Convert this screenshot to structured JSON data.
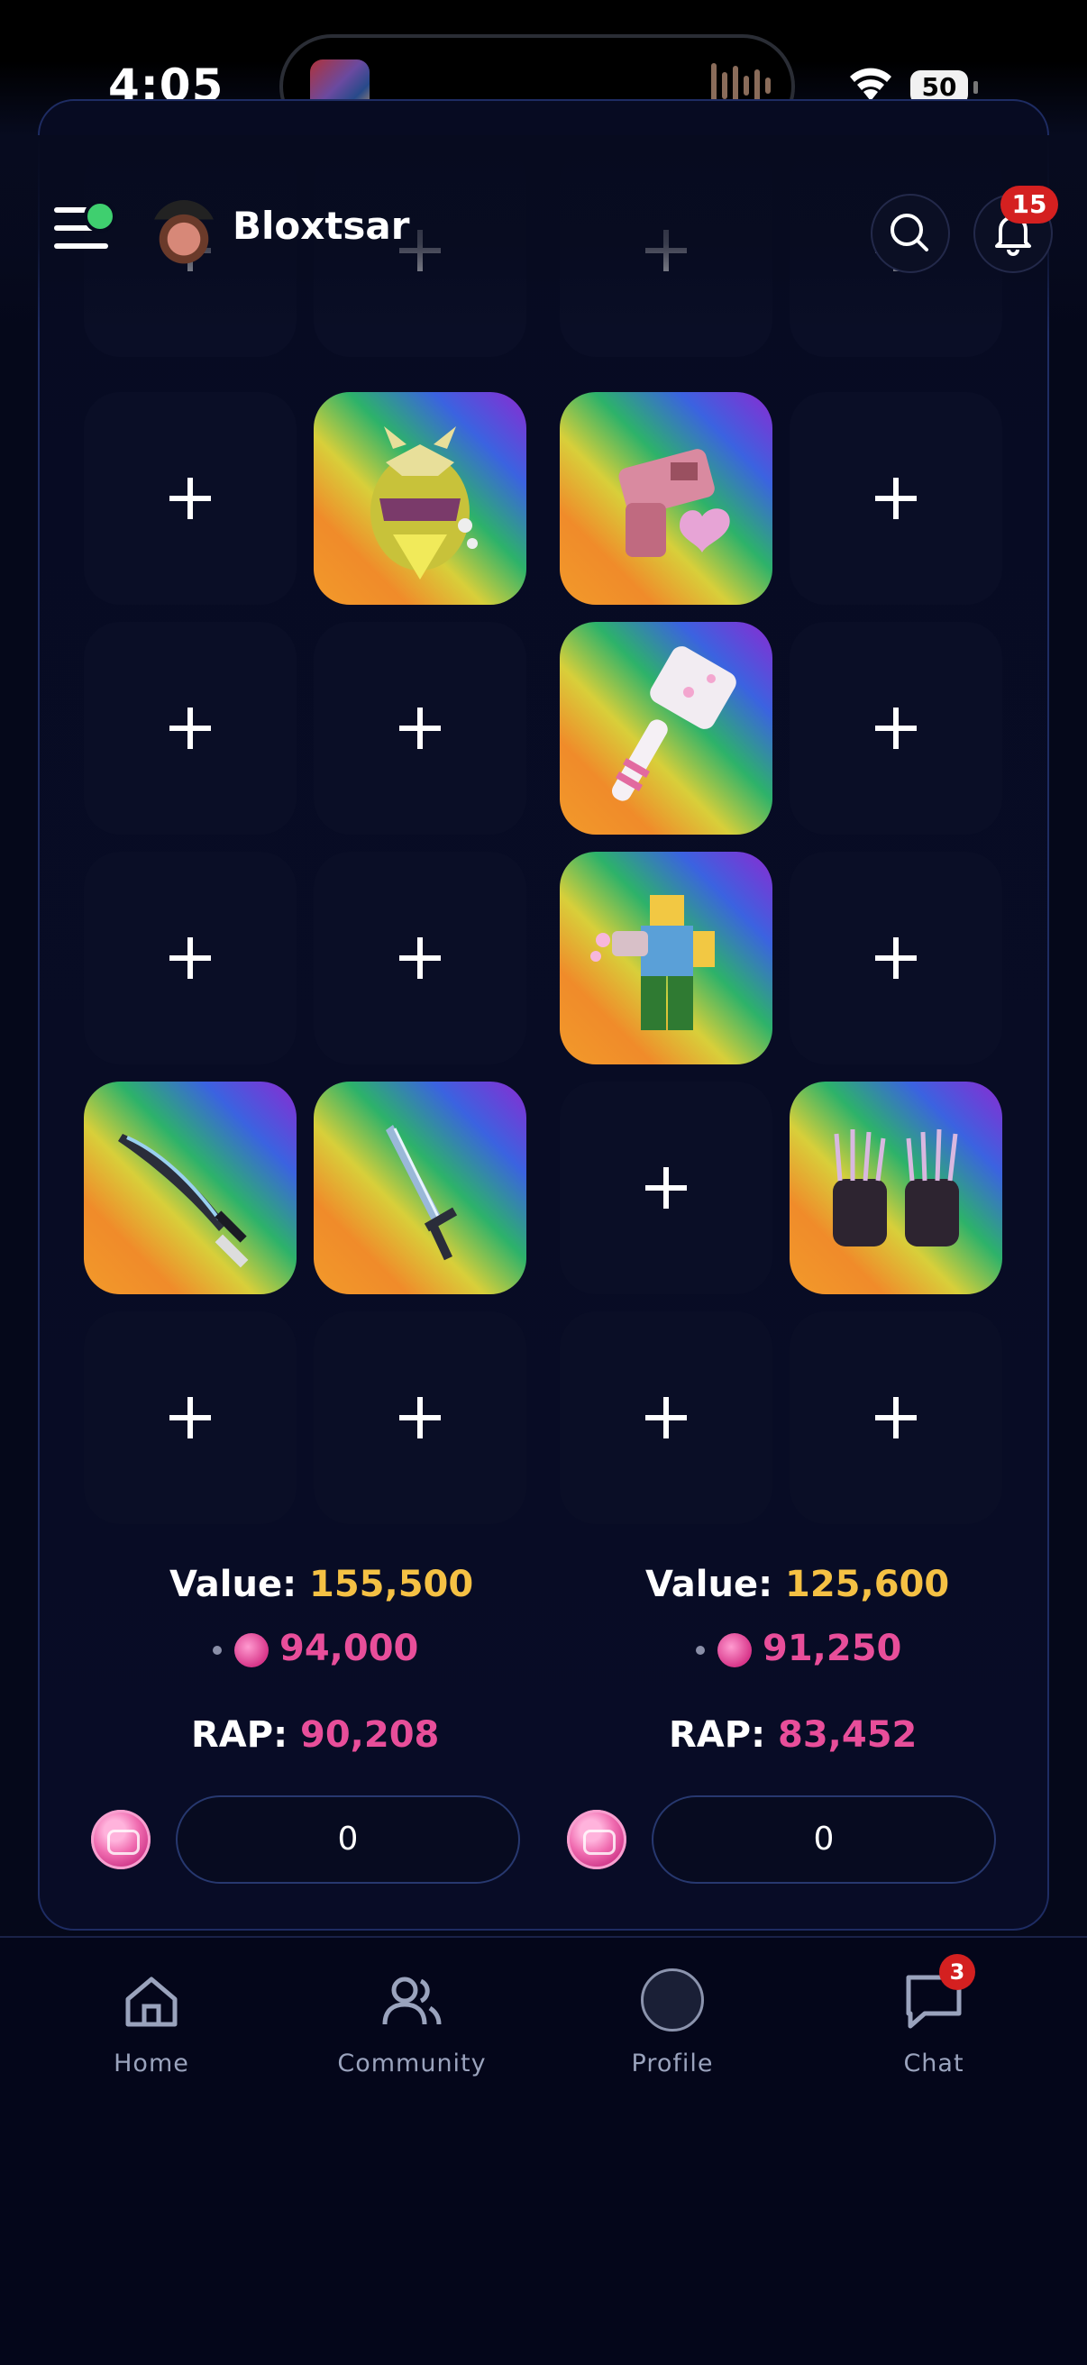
{
  "status_bar": {
    "time": "4:05",
    "battery": "50",
    "icons": [
      "app-thumbnail-icon",
      "audio-waveform-icon",
      "wifi-icon",
      "battery-icon"
    ]
  },
  "header": {
    "username": "Bloxtsar",
    "notification_count": "15",
    "icons": [
      "menu-icon",
      "search-icon",
      "bell-icon"
    ]
  },
  "grid": {
    "left_items": [
      "pineapple-helmet",
      "sword-1",
      "sword-2"
    ],
    "right_items": [
      "pink-blaster",
      "pink-hammer",
      "figure-with-gun",
      "claw-gloves"
    ],
    "empty_slot_icon": "plus-icon"
  },
  "left_summary": {
    "value_label": "Value:",
    "value": "155,500",
    "robux": "94,000",
    "rap_label": "RAP:",
    "rap": "90,208",
    "amount": "0"
  },
  "right_summary": {
    "value_label": "Value:",
    "value": "125,600",
    "robux": "91,250",
    "rap_label": "RAP:",
    "rap": "83,452",
    "amount": "0"
  },
  "tabbar": {
    "tabs": [
      {
        "label": "Home",
        "icon": "home-icon"
      },
      {
        "label": "Community",
        "icon": "users-icon"
      },
      {
        "label": "Profile",
        "icon": "avatar-icon"
      },
      {
        "label": "Chat",
        "icon": "chat-icon"
      }
    ],
    "chat_badge": "3"
  },
  "colors": {
    "background": "#05081a",
    "value_gold": "#f5c144",
    "robux_pink": "#e84e9a",
    "badge_red": "#d42020"
  }
}
